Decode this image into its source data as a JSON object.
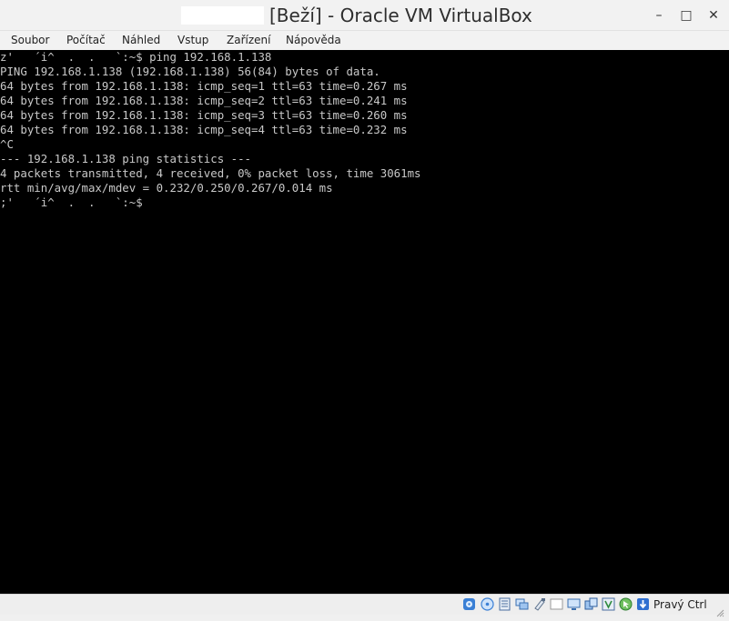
{
  "window": {
    "title": "[Beží] - Oracle VM VirtualBox",
    "controls": {
      "minimize": "–",
      "maximize": "□",
      "close": "✕"
    }
  },
  "menu": {
    "items": [
      "Soubor",
      "Počítač",
      "Náhled",
      "Vstup",
      "Zařízení",
      "Nápověda"
    ]
  },
  "terminal": {
    "lines": [
      "z'   ´i^  .  .   `:~$ ping 192.168.1.138",
      "PING 192.168.1.138 (192.168.1.138) 56(84) bytes of data.",
      "64 bytes from 192.168.1.138: icmp_seq=1 ttl=63 time=0.267 ms",
      "64 bytes from 192.168.1.138: icmp_seq=2 ttl=63 time=0.241 ms",
      "64 bytes from 192.168.1.138: icmp_seq=3 ttl=63 time=0.260 ms",
      "64 bytes from 192.168.1.138: icmp_seq=4 ttl=63 time=0.232 ms",
      "^C",
      "--- 192.168.1.138 ping statistics ---",
      "4 packets transmitted, 4 received, 0% packet loss, time 3061ms",
      "rtt min/avg/max/mdev = 0.232/0.250/0.267/0.014 ms",
      ";'   ´i^  .  .   `:~$"
    ]
  },
  "statusbar": {
    "icons": [
      "hard-disk-icon",
      "optical-drive-icon",
      "audio-icon",
      "network-icon",
      "usb-icon",
      "shared-folders-icon",
      "display-icon",
      "video-capture-icon",
      "virtualization-icon",
      "mouse-integration-icon",
      "keyboard-capture-icon"
    ],
    "host_key": "Pravý Ctrl"
  }
}
